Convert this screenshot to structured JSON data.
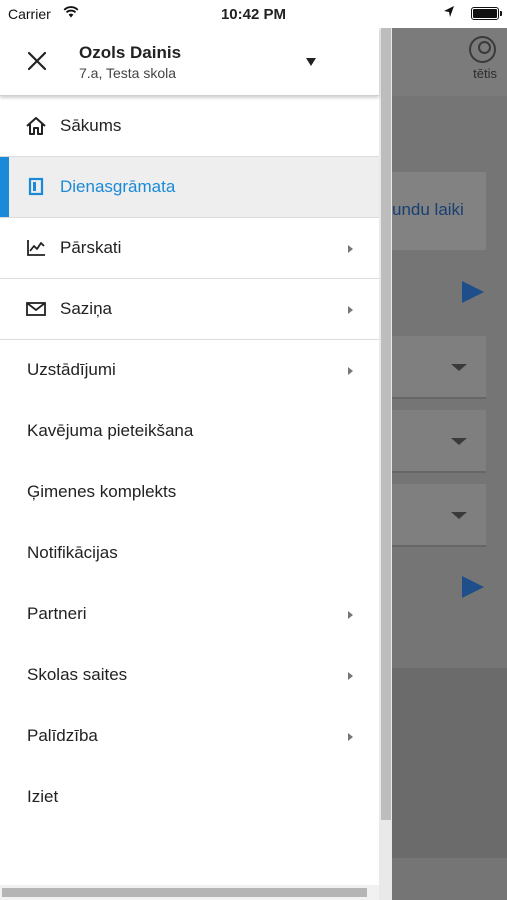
{
  "status_bar": {
    "carrier": "Carrier",
    "time": "10:42 PM",
    "icons": [
      "wifi-icon",
      "location-arrow-icon",
      "battery-icon"
    ]
  },
  "background": {
    "user_label": "tētis",
    "card_text": "undu laiki"
  },
  "drawer": {
    "user": {
      "name": "Ozols Dainis",
      "class": "7.a, Testa skola"
    },
    "menu": [
      {
        "label": "Sākums",
        "icon": "home-icon",
        "has_arrow": false,
        "active": false
      },
      {
        "label": "Dienasgrāmata",
        "icon": "book-icon",
        "has_arrow": false,
        "active": true
      },
      {
        "label": "Pārskati",
        "icon": "chart-icon",
        "has_arrow": true,
        "active": false
      },
      {
        "label": "Saziņa",
        "icon": "envelope-icon",
        "has_arrow": true,
        "active": false
      },
      {
        "label": "Uzstādījumi",
        "has_arrow": true
      },
      {
        "label": "Kavējuma pieteikšana",
        "has_arrow": false
      },
      {
        "label": "Ģimenes komplekts",
        "has_arrow": false
      },
      {
        "label": "Notifikācijas",
        "has_arrow": false
      },
      {
        "label": "Partneri",
        "has_arrow": true
      },
      {
        "label": "Skolas saites",
        "has_arrow": true
      },
      {
        "label": "Palīdzība",
        "has_arrow": true
      },
      {
        "label": "Iziet",
        "has_arrow": false
      }
    ]
  },
  "colors": {
    "accent": "#1a8ad8",
    "active_bg": "#eeeeee",
    "overlay": "#757575"
  }
}
